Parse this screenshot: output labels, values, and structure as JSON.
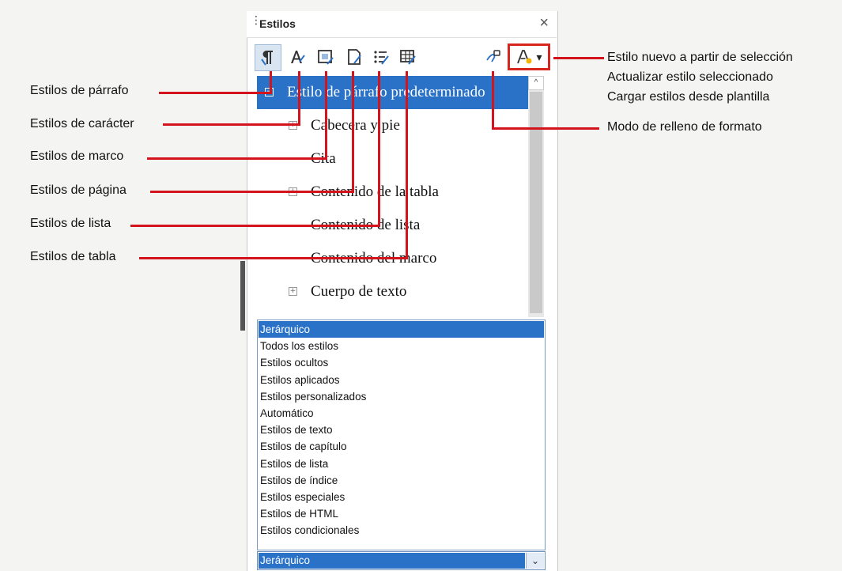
{
  "panel": {
    "title": "Estilos",
    "close_glyph": "×",
    "toolbar": {
      "paragraph_icon": "paragraph-styles-icon",
      "character_icon": "character-styles-icon",
      "frame_icon": "frame-styles-icon",
      "page_icon": "page-styles-icon",
      "list_icon": "list-styles-icon",
      "table_icon": "table-styles-icon",
      "fill_icon": "fill-format-mode-icon",
      "new_style_icon": "new-style-from-selection-icon",
      "dropdown_glyph": "▾"
    },
    "tree": [
      {
        "label": "Estilo de párrafo predeterminado",
        "selected": true,
        "expander": "−"
      },
      {
        "label": "Cabecera y pie",
        "expander": "+"
      },
      {
        "label": "Cita"
      },
      {
        "label": "Contenido de la tabla",
        "expander": "+"
      },
      {
        "label": "Contenido de lista"
      },
      {
        "label": "Contenido del marco"
      },
      {
        "label": "Cuerpo de texto",
        "expander": "+"
      }
    ],
    "filter_options": [
      "Jerárquico",
      "Todos los estilos",
      "Estilos ocultos",
      "Estilos aplicados",
      "Estilos personalizados",
      "Automático",
      "Estilos de texto",
      "Estilos de capítulo",
      "Estilos de lista",
      "Estilos de índice",
      "Estilos especiales",
      "Estilos de HTML",
      "Estilos condicionales"
    ],
    "filter_selected": "Jerárquico"
  },
  "callouts": {
    "left": [
      "Estilos de párrafo",
      "Estilos de carácter",
      "Estilos de marco",
      "Estilos de página",
      "Estilos de lista",
      "Estilos de tabla"
    ],
    "right_menu": [
      "Estilo nuevo a partir de selección",
      "Actualizar estilo seleccionado",
      "Cargar estilos desde plantilla"
    ],
    "right_fill": "Modo de relleno de formato"
  },
  "colors": {
    "callout_line": "#d4141d",
    "selection": "#2a72c8"
  }
}
